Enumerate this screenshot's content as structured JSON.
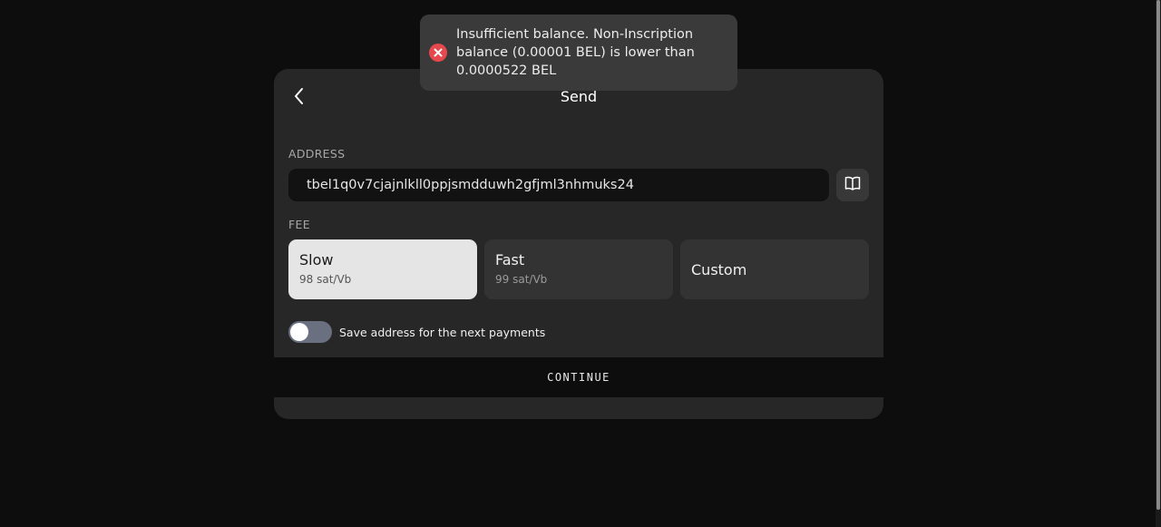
{
  "toast": {
    "icon": "error-icon",
    "message": "Insufficient balance. Non-Inscription balance (0.00001 BEL) is lower than 0.0000522 BEL",
    "color": "#e5484d"
  },
  "header": {
    "title": "Send",
    "back_icon": "chevron-left-icon"
  },
  "address": {
    "label": "ADDRESS",
    "value": "tbel1q0v7cjajnlkll0ppjsmdduwh2gfjml3nhmuks24",
    "book_icon": "book-icon"
  },
  "fee": {
    "label": "FEE",
    "options": [
      {
        "name": "Slow",
        "rate": "98 sat/Vb",
        "selected": true
      },
      {
        "name": "Fast",
        "rate": "99 sat/Vb",
        "selected": false
      },
      {
        "name": "Custom",
        "rate": "",
        "selected": false
      }
    ]
  },
  "save_address": {
    "label": "Save address for the next payments",
    "enabled": false
  },
  "continue_label": "CONTINUE"
}
